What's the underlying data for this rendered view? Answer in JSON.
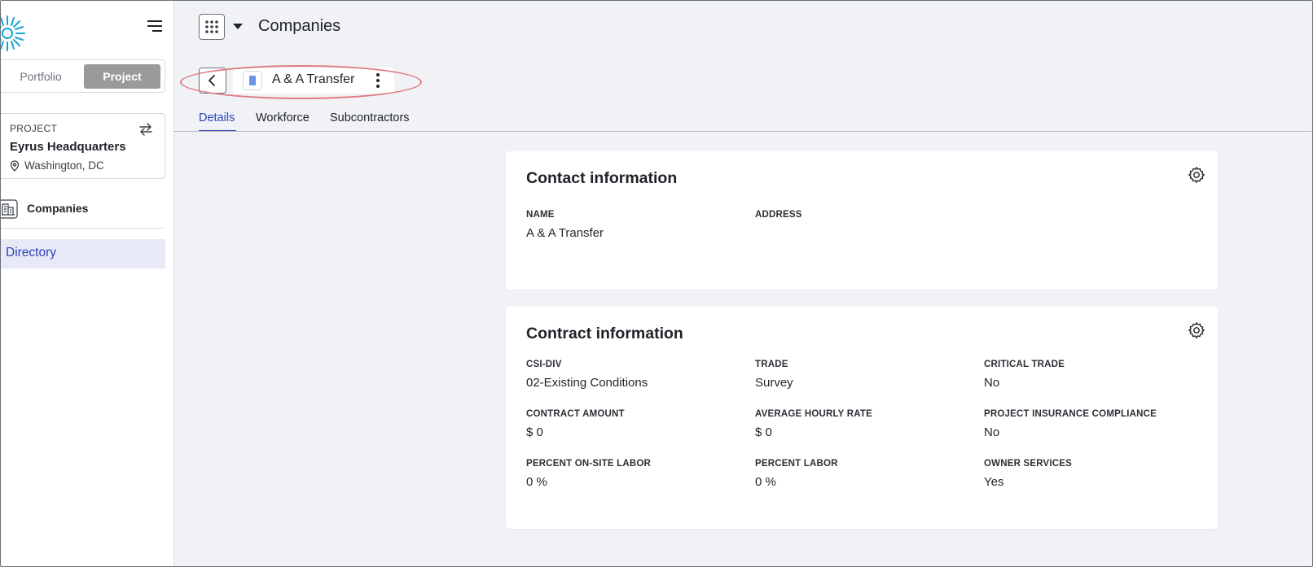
{
  "sidebar": {
    "toggle": {
      "portfolio": "Portfolio",
      "project": "Project"
    },
    "project": {
      "caption": "PROJECT",
      "name": "Eyrus Headquarters",
      "location": "Washington, DC"
    },
    "nav": {
      "companies": "Companies",
      "directory": "Directory"
    }
  },
  "header": {
    "title": "Companies"
  },
  "company": {
    "name": "A & A Transfer"
  },
  "tabs": [
    {
      "label": "Details",
      "active": true
    },
    {
      "label": "Workforce",
      "active": false
    },
    {
      "label": "Subcontractors",
      "active": false
    }
  ],
  "contact": {
    "title": "Contact information",
    "name_label": "NAME",
    "name_value": "A & A Transfer",
    "address_label": "ADDRESS",
    "address_value": ""
  },
  "contract": {
    "title": "Contract information",
    "fields": [
      {
        "label": "CSI-DIV",
        "value": "02-Existing Conditions"
      },
      {
        "label": "TRADE",
        "value": "Survey"
      },
      {
        "label": "CRITICAL TRADE",
        "value": "No"
      },
      {
        "label": "CONTRACT AMOUNT",
        "value": "$ 0"
      },
      {
        "label": "AVERAGE HOURLY RATE",
        "value": "$ 0"
      },
      {
        "label": "PROJECT INSURANCE COMPLIANCE",
        "value": "No"
      },
      {
        "label": "PERCENT ON-SITE LABOR",
        "value": "0 %"
      },
      {
        "label": "PERCENT LABOR",
        "value": "0 %"
      },
      {
        "label": "OWNER SERVICES",
        "value": "Yes"
      }
    ]
  },
  "colors": {
    "accent": "#2c43b8",
    "active_nav_bg": "#e7e9f6",
    "highlight": "#e07b7f",
    "logo": "#1aa3d9"
  },
  "icons": [
    "logo-sunburst-icon",
    "hamburger-menu-icon",
    "swap-icon",
    "location-pin-icon",
    "building-icon",
    "apps-grid-icon",
    "caret-down-icon",
    "chevron-left-icon",
    "bookmark-icon",
    "kebab-menu-icon",
    "gear-icon"
  ]
}
